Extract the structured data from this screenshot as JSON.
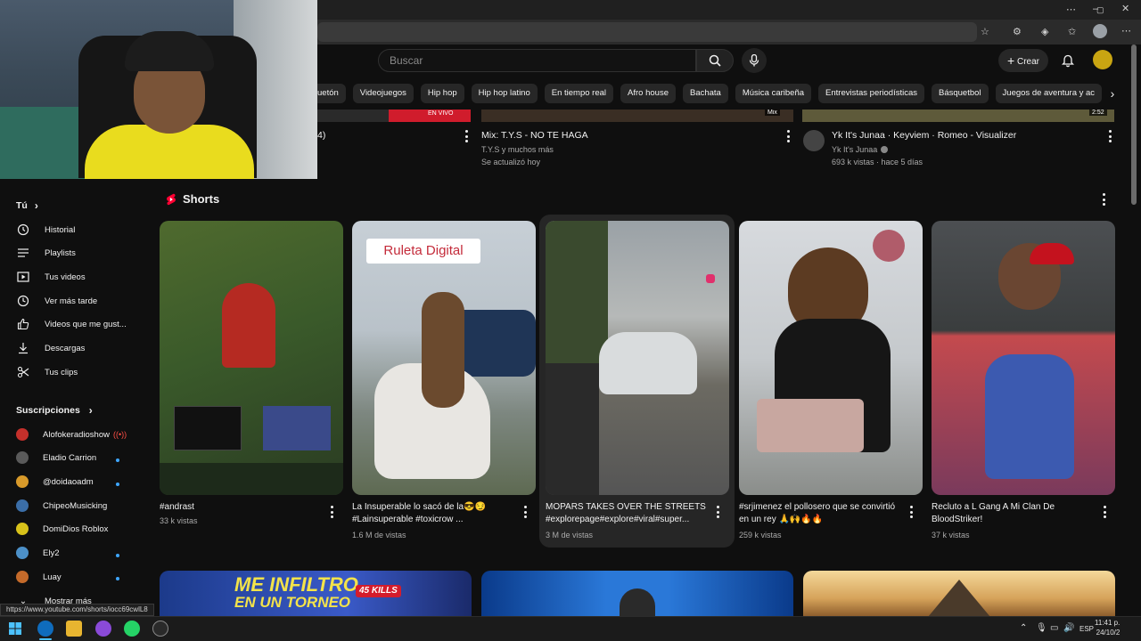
{
  "search": {
    "placeholder": "Buscar"
  },
  "header": {
    "create_label": "Crear"
  },
  "chips": [
    "uetón",
    "Videojuegos",
    "Hip hop",
    "Hip hop latino",
    "En tiempo real",
    "Afro house",
    "Bachata",
    "Música caribeña",
    "Entrevistas periodísticas",
    "Básquetbol",
    "Juegos de aventura y ac"
  ],
  "top_videos": [
    {
      "title": "4)",
      "badge": "EN VIVO",
      "channel": "",
      "meta": ""
    },
    {
      "title": "Mix: T.Y.S - NO TE HAGA",
      "badge": "Mix",
      "channel": "T.Y.S y muchos más",
      "meta": "Se actualizó hoy"
    },
    {
      "title": "Yk It's Junaa · Keyviem · Romeo - Visualizer",
      "badge": "2:52",
      "channel": "Yk It's Junaa",
      "meta": "693 k vistas · hace 5 días"
    }
  ],
  "sidebar": {
    "you_label": "Tú",
    "items": [
      {
        "label": "Historial",
        "icon": "history-icon"
      },
      {
        "label": "Playlists",
        "icon": "playlist-icon"
      },
      {
        "label": "Tus videos",
        "icon": "video-icon"
      },
      {
        "label": "Ver más tarde",
        "icon": "clock-icon"
      },
      {
        "label": "Videos que me gust...",
        "icon": "thumbs-up-icon"
      },
      {
        "label": "Descargas",
        "icon": "download-icon"
      },
      {
        "label": "Tus clips",
        "icon": "scissors-icon"
      }
    ],
    "subs_label": "Suscripciones",
    "subscriptions": [
      {
        "name": "Alofokeradioshow",
        "color": "#c4302b",
        "live": true
      },
      {
        "name": "Eladio Carrion",
        "color": "#5a5a5a",
        "live": false,
        "dot": true
      },
      {
        "name": "@doidaoadm",
        "color": "#d89a2a",
        "live": false,
        "dot": true
      },
      {
        "name": "ChipeoMusicking",
        "color": "#3b6ea8",
        "live": false,
        "dot": false
      },
      {
        "name": "DomiDios Roblox",
        "color": "#d8c21a",
        "live": false,
        "dot": false
      },
      {
        "name": "Ely2",
        "color": "#4c90c8",
        "live": false,
        "dot": true
      },
      {
        "name": "Luay",
        "color": "#c46a2a",
        "live": false,
        "dot": true
      }
    ],
    "more_label": "Mostrar más"
  },
  "shorts": {
    "heading": "Shorts",
    "items": [
      {
        "title": "#andrast",
        "views": "33 k vistas"
      },
      {
        "title": "La Insuperable lo sacó de la😎😏 #Lainsuperable #toxicrow ...",
        "views": "1.6 M de vistas",
        "overlay": "Ruleta Digital"
      },
      {
        "title": "MOPARS TAKES OVER THE STREETS #explorepage#explore#viral#super...",
        "views": "3 M de vistas"
      },
      {
        "title": "#srjimenez el pollosero que se convirtió en un rey 🙏🙌🔥🔥",
        "views": "259 k vistas"
      },
      {
        "title": "Recluto a L Gang A Mi Clan De BloodStriker!",
        "views": "37 k vistas"
      }
    ]
  },
  "bottom_thumbs": [
    {
      "line1": "ME INFILTRO",
      "line2": "EN UN TORNEO",
      "badge": "45 KILLS"
    },
    {
      "line1": "",
      "line2": "",
      "badge": ""
    },
    {
      "line1": "",
      "line2": "",
      "badge": ""
    }
  ],
  "status_url": "https://www.youtube.com/shorts/iocc69cwlL8",
  "taskbar": {
    "time": "11:41 p.",
    "date": "24/10/2",
    "lang": "ESP"
  }
}
